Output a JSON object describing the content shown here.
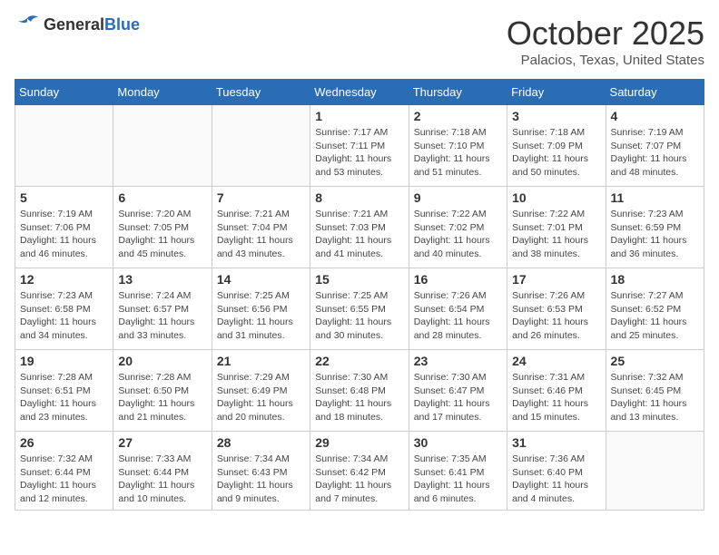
{
  "header": {
    "logo_general": "General",
    "logo_blue": "Blue",
    "month_title": "October 2025",
    "subtitle": "Palacios, Texas, United States"
  },
  "days_of_week": [
    "Sunday",
    "Monday",
    "Tuesday",
    "Wednesday",
    "Thursday",
    "Friday",
    "Saturday"
  ],
  "weeks": [
    [
      {
        "day": "",
        "info": ""
      },
      {
        "day": "",
        "info": ""
      },
      {
        "day": "",
        "info": ""
      },
      {
        "day": "1",
        "info": "Sunrise: 7:17 AM\nSunset: 7:11 PM\nDaylight: 11 hours and 53 minutes."
      },
      {
        "day": "2",
        "info": "Sunrise: 7:18 AM\nSunset: 7:10 PM\nDaylight: 11 hours and 51 minutes."
      },
      {
        "day": "3",
        "info": "Sunrise: 7:18 AM\nSunset: 7:09 PM\nDaylight: 11 hours and 50 minutes."
      },
      {
        "day": "4",
        "info": "Sunrise: 7:19 AM\nSunset: 7:07 PM\nDaylight: 11 hours and 48 minutes."
      }
    ],
    [
      {
        "day": "5",
        "info": "Sunrise: 7:19 AM\nSunset: 7:06 PM\nDaylight: 11 hours and 46 minutes."
      },
      {
        "day": "6",
        "info": "Sunrise: 7:20 AM\nSunset: 7:05 PM\nDaylight: 11 hours and 45 minutes."
      },
      {
        "day": "7",
        "info": "Sunrise: 7:21 AM\nSunset: 7:04 PM\nDaylight: 11 hours and 43 minutes."
      },
      {
        "day": "8",
        "info": "Sunrise: 7:21 AM\nSunset: 7:03 PM\nDaylight: 11 hours and 41 minutes."
      },
      {
        "day": "9",
        "info": "Sunrise: 7:22 AM\nSunset: 7:02 PM\nDaylight: 11 hours and 40 minutes."
      },
      {
        "day": "10",
        "info": "Sunrise: 7:22 AM\nSunset: 7:01 PM\nDaylight: 11 hours and 38 minutes."
      },
      {
        "day": "11",
        "info": "Sunrise: 7:23 AM\nSunset: 6:59 PM\nDaylight: 11 hours and 36 minutes."
      }
    ],
    [
      {
        "day": "12",
        "info": "Sunrise: 7:23 AM\nSunset: 6:58 PM\nDaylight: 11 hours and 34 minutes."
      },
      {
        "day": "13",
        "info": "Sunrise: 7:24 AM\nSunset: 6:57 PM\nDaylight: 11 hours and 33 minutes."
      },
      {
        "day": "14",
        "info": "Sunrise: 7:25 AM\nSunset: 6:56 PM\nDaylight: 11 hours and 31 minutes."
      },
      {
        "day": "15",
        "info": "Sunrise: 7:25 AM\nSunset: 6:55 PM\nDaylight: 11 hours and 30 minutes."
      },
      {
        "day": "16",
        "info": "Sunrise: 7:26 AM\nSunset: 6:54 PM\nDaylight: 11 hours and 28 minutes."
      },
      {
        "day": "17",
        "info": "Sunrise: 7:26 AM\nSunset: 6:53 PM\nDaylight: 11 hours and 26 minutes."
      },
      {
        "day": "18",
        "info": "Sunrise: 7:27 AM\nSunset: 6:52 PM\nDaylight: 11 hours and 25 minutes."
      }
    ],
    [
      {
        "day": "19",
        "info": "Sunrise: 7:28 AM\nSunset: 6:51 PM\nDaylight: 11 hours and 23 minutes."
      },
      {
        "day": "20",
        "info": "Sunrise: 7:28 AM\nSunset: 6:50 PM\nDaylight: 11 hours and 21 minutes."
      },
      {
        "day": "21",
        "info": "Sunrise: 7:29 AM\nSunset: 6:49 PM\nDaylight: 11 hours and 20 minutes."
      },
      {
        "day": "22",
        "info": "Sunrise: 7:30 AM\nSunset: 6:48 PM\nDaylight: 11 hours and 18 minutes."
      },
      {
        "day": "23",
        "info": "Sunrise: 7:30 AM\nSunset: 6:47 PM\nDaylight: 11 hours and 17 minutes."
      },
      {
        "day": "24",
        "info": "Sunrise: 7:31 AM\nSunset: 6:46 PM\nDaylight: 11 hours and 15 minutes."
      },
      {
        "day": "25",
        "info": "Sunrise: 7:32 AM\nSunset: 6:45 PM\nDaylight: 11 hours and 13 minutes."
      }
    ],
    [
      {
        "day": "26",
        "info": "Sunrise: 7:32 AM\nSunset: 6:44 PM\nDaylight: 11 hours and 12 minutes."
      },
      {
        "day": "27",
        "info": "Sunrise: 7:33 AM\nSunset: 6:44 PM\nDaylight: 11 hours and 10 minutes."
      },
      {
        "day": "28",
        "info": "Sunrise: 7:34 AM\nSunset: 6:43 PM\nDaylight: 11 hours and 9 minutes."
      },
      {
        "day": "29",
        "info": "Sunrise: 7:34 AM\nSunset: 6:42 PM\nDaylight: 11 hours and 7 minutes."
      },
      {
        "day": "30",
        "info": "Sunrise: 7:35 AM\nSunset: 6:41 PM\nDaylight: 11 hours and 6 minutes."
      },
      {
        "day": "31",
        "info": "Sunrise: 7:36 AM\nSunset: 6:40 PM\nDaylight: 11 hours and 4 minutes."
      },
      {
        "day": "",
        "info": ""
      }
    ]
  ]
}
